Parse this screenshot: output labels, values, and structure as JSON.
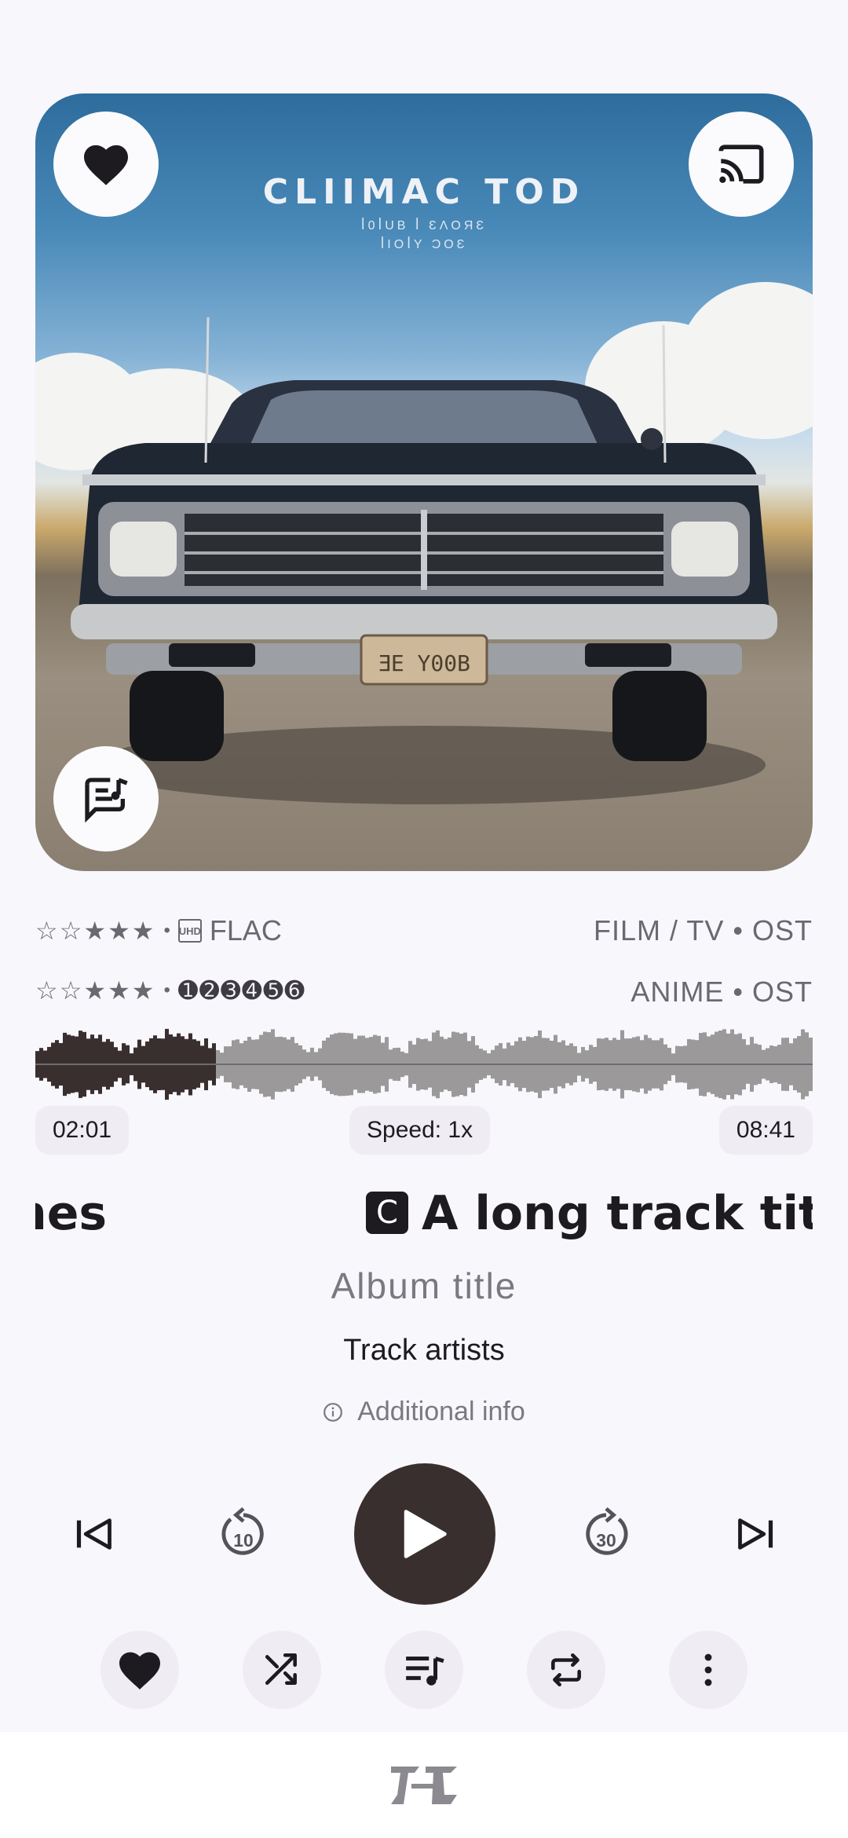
{
  "artwork": {
    "title": "CLIIMAC TOD",
    "subtitle_line1": "ꟾ0ꟾUB ꟾ ƐɅOЯƐ",
    "subtitle_line2": "ꟾIOꟾY ƆOƐ",
    "plate": "ƎE Y00B"
  },
  "meta": {
    "row1_stars": "☆☆★★★",
    "row1_sep": "•",
    "row1_format_badge": "UHD",
    "row1_format": "FLAC",
    "row1_genre": "FILM / TV • OST",
    "row2_stars": "☆☆★★★",
    "row2_sep": "•",
    "row2_numbers": "➊➋➌➍➎➏",
    "row2_genre": "ANIME • OST"
  },
  "progress": {
    "elapsed": "02:01",
    "speed": "Speed: 1x",
    "duration": "08:41",
    "played_fraction": 0.23
  },
  "track": {
    "prev_title_tail": "nes",
    "badge": "C",
    "title": "A long track title",
    "album": "Album title",
    "artists": "Track artists",
    "additional_info": "Additional info"
  },
  "controls": {
    "skip_back_seconds": "10",
    "skip_forward_seconds": "30"
  },
  "colors": {
    "accent_dark": "#3a2f2f",
    "waveform_played": "#3a2f2f",
    "waveform_unplayed": "#9b9999",
    "chip_bg": "#efedf3"
  }
}
